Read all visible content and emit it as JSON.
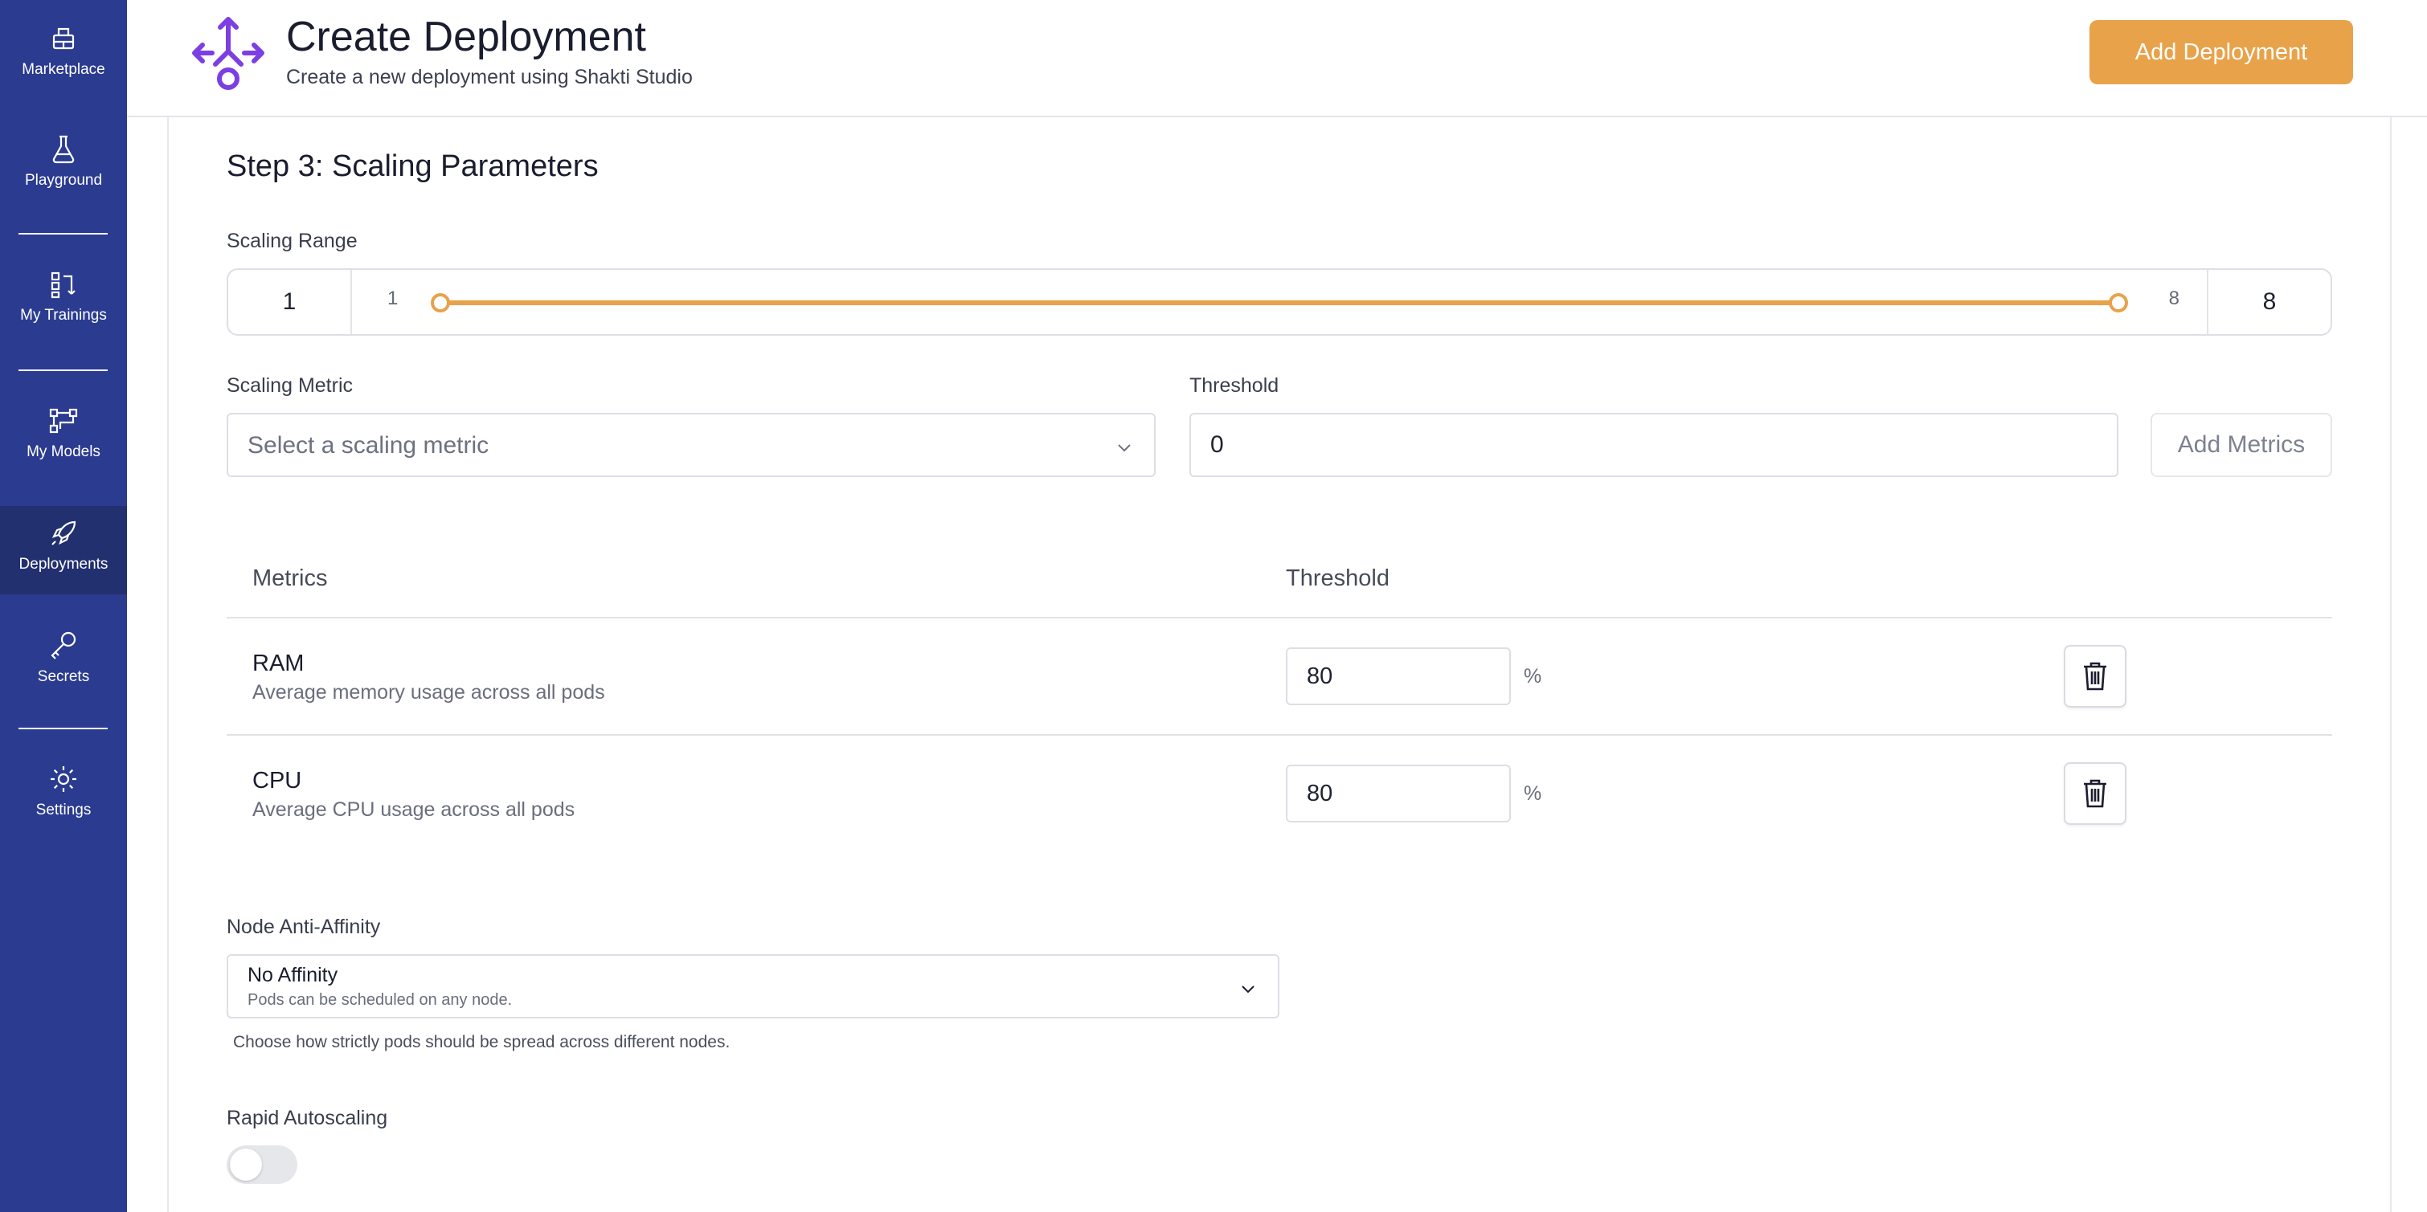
{
  "sidebar": {
    "items": [
      {
        "label": "Marketplace",
        "icon": "marketplace-icon"
      },
      {
        "label": "Playground",
        "icon": "flask-icon"
      },
      {
        "label": "My Trainings",
        "icon": "trainings-icon"
      },
      {
        "label": "My Models",
        "icon": "models-icon"
      },
      {
        "label": "Deployments",
        "icon": "rocket-icon",
        "active": true
      },
      {
        "label": "Secrets",
        "icon": "key-icon"
      },
      {
        "label": "Settings",
        "icon": "gear-icon"
      }
    ]
  },
  "header": {
    "title": "Create Deployment",
    "subtitle": "Create a new deployment using Shakti Studio",
    "help_icon": "help-circle-icon",
    "add_button": "Add Deployment"
  },
  "colors": {
    "sidebar_bg": "#2b3b8f",
    "accent": "#e8a24a",
    "logo": "#7b3fe4"
  },
  "step": {
    "title": "Step 3: Scaling Parameters"
  },
  "scaling_range": {
    "label": "Scaling Range",
    "min_value": "1",
    "max_value": "8",
    "min_label": "1",
    "max_label": "8",
    "slider_low": 1,
    "slider_high": 8
  },
  "metric_form": {
    "metric_label": "Scaling Metric",
    "metric_placeholder": "Select a scaling metric",
    "threshold_label": "Threshold",
    "threshold_value": "0",
    "add_button": "Add Metrics"
  },
  "metrics_table": {
    "headers": {
      "metrics": "Metrics",
      "threshold": "Threshold"
    },
    "rows": [
      {
        "name": "RAM",
        "description": "Average memory usage across all pods",
        "threshold": "80",
        "unit": "%"
      },
      {
        "name": "CPU",
        "description": "Average CPU usage across all pods",
        "threshold": "80",
        "unit": "%"
      }
    ]
  },
  "node_affinity": {
    "label": "Node Anti-Affinity",
    "selected_title": "No Affinity",
    "selected_subtitle": "Pods can be scheduled on any node.",
    "help": "Choose how strictly pods should be spread across different nodes."
  },
  "rapid_autoscaling": {
    "label": "Rapid Autoscaling",
    "enabled": false
  }
}
